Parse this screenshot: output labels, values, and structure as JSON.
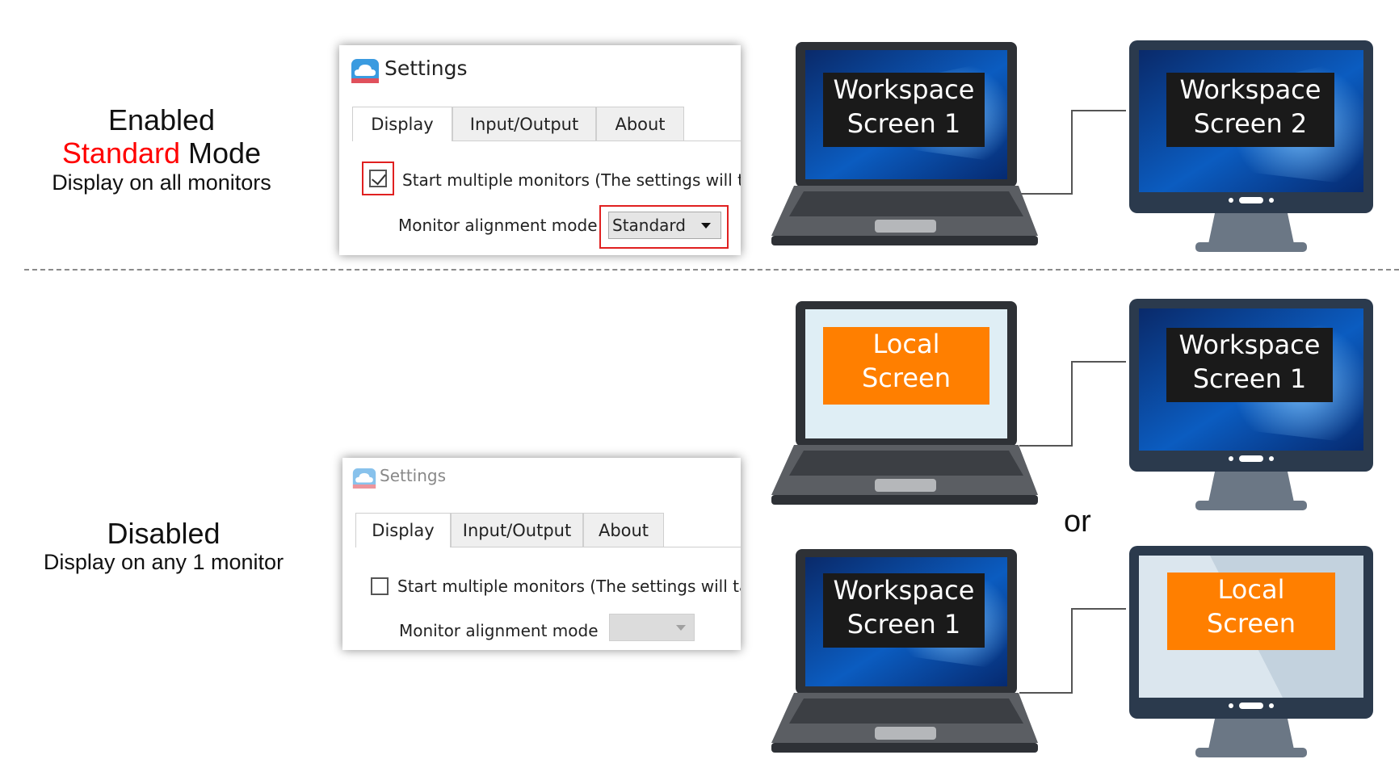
{
  "modes": {
    "enabled": {
      "title_prefix": "Enabled",
      "mode_word": "Standard",
      "mode_suffix": " Mode",
      "description": "Display on all monitors"
    },
    "disabled": {
      "title": "Disabled",
      "description": "Display on any 1 monitor"
    }
  },
  "dialog_enabled": {
    "title": "Settings",
    "tabs": [
      "Display",
      "Input/Output",
      "About"
    ],
    "checkbox_label": "Start multiple monitors (The settings will ta",
    "checkbox_checked": true,
    "alignment_label": "Monitor alignment mode",
    "alignment_value": "Standard"
  },
  "dialog_disabled": {
    "title": "Settings",
    "tabs": [
      "Display",
      "Input/Output",
      "About"
    ],
    "checkbox_label": "Start multiple monitors (The settings will ta",
    "checkbox_checked": false,
    "alignment_label": "Monitor alignment mode",
    "alignment_value": ""
  },
  "screens": {
    "top_laptop": [
      "Workspace",
      "Screen 1"
    ],
    "top_monitor": [
      "Workspace",
      "Screen 2"
    ],
    "mid_laptop": [
      "Local",
      "Screen"
    ],
    "mid_monitor": [
      "Workspace",
      "Screen 1"
    ],
    "bot_laptop": [
      "Workspace",
      "Screen 1"
    ],
    "bot_monitor": [
      "Local",
      "Screen"
    ]
  },
  "or_text": "or",
  "colors": {
    "highlight": "#e02020",
    "standard_word": "#ff0000",
    "local_label": "#ff7f00",
    "device_body": "#2b3a4d",
    "windows_blue": "#0a5fb4"
  }
}
